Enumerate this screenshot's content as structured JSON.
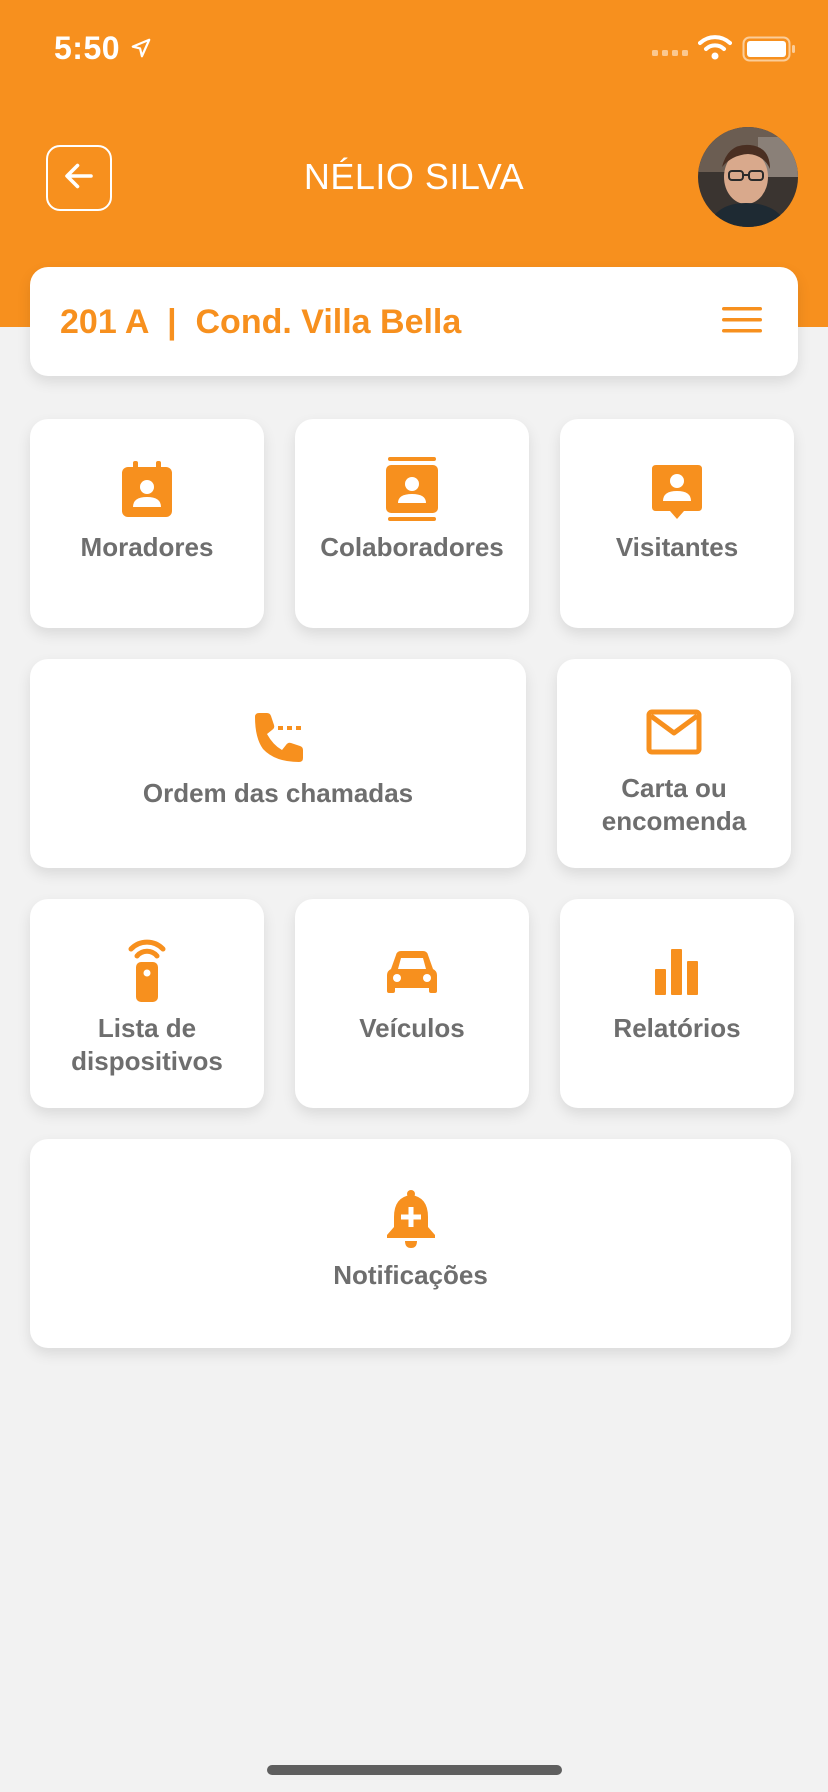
{
  "status_bar": {
    "time": "5:50"
  },
  "header": {
    "title": "NÉLIO SILVA",
    "back_icon": "arrow-left-icon",
    "avatar_icon": "user-photo"
  },
  "unit": {
    "label": "201 A  |  Cond. Villa Bella",
    "menu_icon": "hamburger-menu-icon"
  },
  "tiles": [
    {
      "label": "Moradores",
      "icon": "calendar-person-icon"
    },
    {
      "label": "Colaboradores",
      "icon": "contacts-icon"
    },
    {
      "label": "Visitantes",
      "icon": "person-pin-icon"
    },
    {
      "label": "Ordem das chamadas",
      "icon": "phone-in-talk-icon"
    },
    {
      "label": "Carta ou encomenda",
      "icon": "mail-icon"
    },
    {
      "label": "Lista de dispositivos",
      "icon": "remote-device-icon"
    },
    {
      "label": "Veículos",
      "icon": "car-icon"
    },
    {
      "label": "Relatórios",
      "icon": "bar-chart-icon"
    },
    {
      "label": "Notificações",
      "icon": "bell-plus-icon"
    }
  ],
  "colors": {
    "accent": "#f7901e",
    "background": "#f2f2f2",
    "tile_text": "#6e6e6e"
  }
}
